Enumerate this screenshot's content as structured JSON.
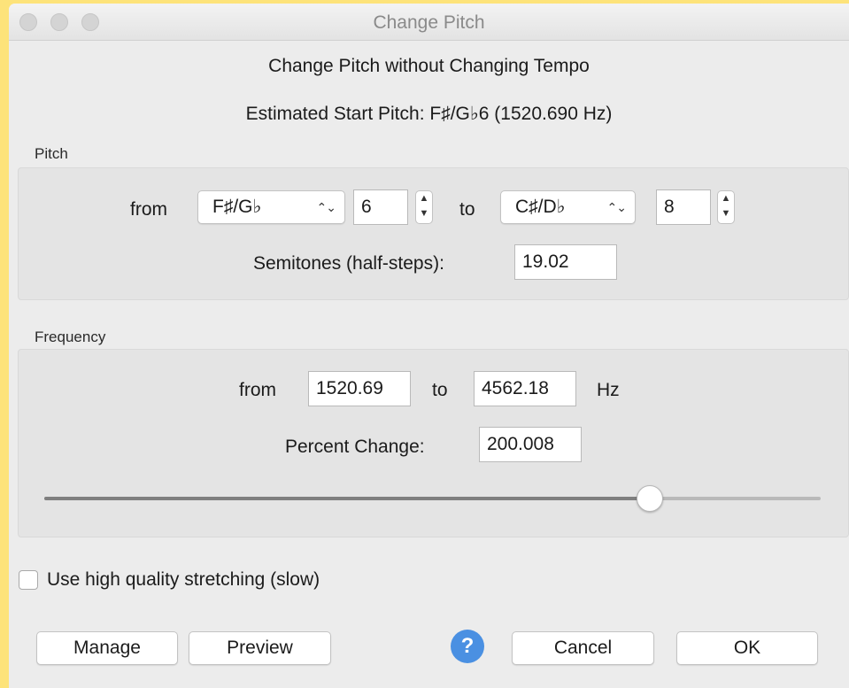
{
  "window": {
    "title": "Change Pitch"
  },
  "header": {
    "title": "Change Pitch without Changing Tempo",
    "estimate": "Estimated Start Pitch: F♯/G♭6 (1520.690 Hz)"
  },
  "pitch": {
    "group_label": "Pitch",
    "from_label": "from",
    "from_note": "F♯/G♭",
    "from_octave": "6",
    "to_label": "to",
    "to_note": "C♯/D♭",
    "to_octave": "8",
    "semitones_label": "Semitones (half-steps):",
    "semitones_value": "19.02"
  },
  "frequency": {
    "group_label": "Frequency",
    "from_label": "from",
    "from_value": "1520.69",
    "to_label": "to",
    "to_value": "4562.18",
    "unit": "Hz",
    "percent_label": "Percent Change:",
    "percent_value": "200.008",
    "slider_fraction": 0.78
  },
  "options": {
    "high_quality_label": "Use high quality stretching (slow)",
    "high_quality_checked": false
  },
  "buttons": {
    "manage": "Manage",
    "preview": "Preview",
    "help_icon": "?",
    "cancel": "Cancel",
    "ok": "OK"
  },
  "colors": {
    "background": "#fde37a",
    "help_blue": "#4a90e2"
  }
}
